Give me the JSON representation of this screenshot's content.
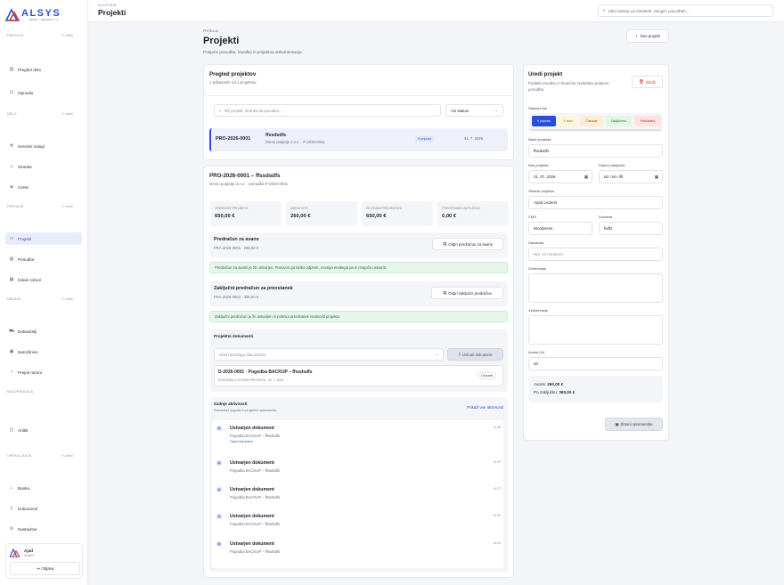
{
  "sidebar": {
    "logo_text": "ALSYS",
    "logo_tagline": "SPLET • GRAFIKA • IT",
    "sections": [
      {
        "label": "PREGLED",
        "edit": "Uredi"
      },
      {
        "label": "DELO",
        "edit": "Uredi"
      },
      {
        "label": "PRODAJA",
        "edit": "Uredi"
      },
      {
        "label": "NABAVA",
        "edit": "Uredi"
      },
      {
        "label": "MALOPRODAJA"
      },
      {
        "label": "UPRAVLJANJE",
        "edit": "Uredi"
      }
    ],
    "items": [
      {
        "label": "Pregled dela",
        "icon": "chart-icon"
      },
      {
        "label": "Opravila",
        "icon": "checklist-icon"
      },
      {
        "label": "Servisni nalogi",
        "icon": "wrench-icon"
      },
      {
        "label": "Stranke",
        "icon": "users-icon"
      },
      {
        "label": "Cenik",
        "icon": "tag-icon"
      },
      {
        "label": "Projekti",
        "icon": "folder-icon"
      },
      {
        "label": "Ponudbe",
        "icon": "document-icon"
      },
      {
        "label": "Izdani računi",
        "icon": "invoice-icon"
      },
      {
        "label": "Dobavitelji",
        "icon": "truck-icon"
      },
      {
        "label": "Naročilnice",
        "icon": "clipboard-icon"
      },
      {
        "label": "Prejeti računi",
        "icon": "inbox-icon"
      },
      {
        "label": "Artikli",
        "icon": "box-icon"
      },
      {
        "label": "Banka",
        "icon": "bank-icon"
      },
      {
        "label": "Dokumenti",
        "icon": "file-icon"
      },
      {
        "label": "Nastavitve",
        "icon": "gear-icon"
      }
    ],
    "user": {
      "name": "Ajad",
      "role": "ADMIN",
      "logout": "Odjava"
    }
  },
  "header": {
    "breadcrumb": "ALSYS HUB",
    "title": "Projekti",
    "search_placeholder": "Hitro iskanje po strankah, nalogih, ponudbah..."
  },
  "page": {
    "kicker": "PRODAJA",
    "title": "Projekti",
    "subtitle": "Potrjene ponudbe, izvedba in projektna dokumentacija.",
    "new_button": "Nov projekt"
  },
  "overview": {
    "title": "Pregled projektov",
    "count_text": "1 prikazanih od 1 projektov.",
    "search_placeholder": "Išči projekt, stranko ali ponudbo...",
    "status_filter": "Vsi statusi",
    "rows": [
      {
        "code": "PRO-2026-0001",
        "name": "ffssdsdfs",
        "client": "Demo podjetje d.o.o. · P-2026-0001",
        "status": "V pripravi",
        "date": "31. 7. 2026"
      }
    ]
  },
  "detail": {
    "title": "PRO-2026-0001 – ffssdsdfs",
    "subtitle": "Demo podjetje d.o.o. · ponudba P-2026-0001",
    "stats": [
      {
        "label": "VREDNOST PROJEKTA",
        "value": "650,00 €"
      },
      {
        "label": "AVANS 40 %",
        "value": "260,00 €"
      },
      {
        "label": "ŽE IZDANI PREDRAČUNI",
        "value": "650,00 €"
      },
      {
        "label": "PREOSTANEK ZA PLAČILO",
        "value": "0,00 €"
      }
    ],
    "advance": {
      "title": "Predračun za avans",
      "sub": "PRA-2026-0001 · 260,00 €",
      "button": "Odpri predračun za avans",
      "notice": "Predračun za avans je že ustvarjen. Ponovno ga lahko odprete, novega enakega pa ni mogoče ustvariti."
    },
    "final": {
      "title": "Zaključni predračun za preostanek",
      "sub": "PRA-2026-0002 · 390,00 €",
      "button": "Odpri zaključni predračun",
      "notice": "Zaključni predračun je že ustvarjen in pokriva preostanek vrednosti projekta."
    },
    "documents": {
      "title": "Projektni dokumenti",
      "template_placeholder": "Izberi predlogo dokumenta",
      "create_button": "Ustvari dokument",
      "doc_title": "D-2026-0001 · Pogodba BACKUP – ffssdsdfs",
      "doc_meta": "POGODBA O IZVEDBI PROJEKTA · 20. 7. 2026",
      "doc_badge": "Osnutek"
    },
    "activity": {
      "title": "Zadnje aktivnosti",
      "sub": "Pomembni dogodki in projektne spremembe.",
      "show_all": "Prikaži vse aktivnosti",
      "items": [
        {
          "title": "Ustvarjen dokument",
          "sub": "Pogodba BACKUP – ffssdsdfs",
          "link": "Odpri dokument",
          "time": "14:38"
        },
        {
          "title": "Ustvarjen dokument",
          "sub": "Pogodba BACKUP – ffssdsdfs",
          "time": "14:29"
        },
        {
          "title": "Ustvarjen dokument",
          "sub": "Pogodba BACKUP – ffssdsdfs",
          "time": "14:27"
        },
        {
          "title": "Ustvarjen dokument",
          "sub": "Pogodba BACKUP – ffssdsdfs",
          "time": "14:26"
        },
        {
          "title": "Ustvarjen dokument",
          "sub": "Pogodba BACKUP – ffssdsdfs",
          "time": "14:26"
        }
      ]
    }
  },
  "edit_panel": {
    "title": "Uredi projekt",
    "subtitle": "Podatki izvedbe in finančne razdelitve potrjene ponudbe.",
    "delete_button": "Izbriši",
    "status_label": "Statusni tok",
    "statuses": [
      {
        "label": "V pripravi",
        "active": true
      },
      {
        "label": "V teku"
      },
      {
        "label": "Čakanje"
      },
      {
        "label": "Zaključeno"
      },
      {
        "label": "Preklicano"
      }
    ],
    "name_label": "Naziv projekta",
    "name_value": "ffssdsdfs",
    "deadline_label": "Rok projekta",
    "deadline_value": "31. 07. 2026",
    "completion_label": "Datum zaključka",
    "completion_value": "dd. mm. llll",
    "manager_label": "Skrbnik projekta",
    "manager_value": "Arjad Lederer",
    "cms_label": "CMS",
    "cms_value": "Wordpress",
    "domain_label": "Domena",
    "domain_value": "fsdfs",
    "warranty_label": "Garancija",
    "warranty_placeholder": "Npr. 12 mesecev",
    "hosting_label": "Gostovanje",
    "maintenance_label": "Vzdrževanje",
    "advance_label": "Avans (%)",
    "advance_value": "40",
    "summary_advance_label": "Avans:",
    "summary_advance_value": "260,00 €",
    "summary_final_label": "Po zaključku:",
    "summary_final_value": "390,00 €",
    "save_button": "Shrani spremembe"
  },
  "colors": {
    "accent": "#2a4fd7",
    "danger": "#d93636",
    "success_bg": "#e6f6ea"
  }
}
